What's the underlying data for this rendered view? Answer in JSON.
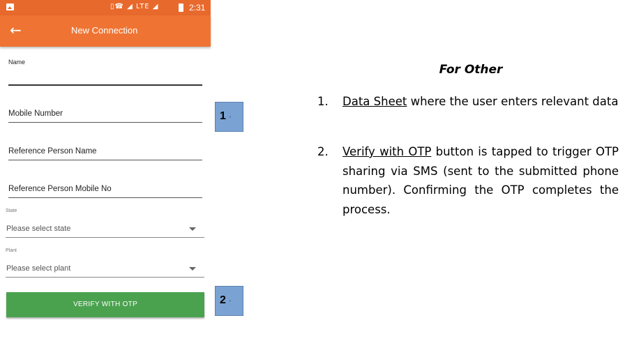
{
  "status_bar": {
    "network_icons": "▯☎ ◢ LTE ◢",
    "time": "2:31"
  },
  "app_bar": {
    "back_glyph": "←",
    "title": "New Connection"
  },
  "form": {
    "name_label": "Name",
    "mobile_label": "Mobile Number",
    "ref_name_label": "Reference Person Name",
    "ref_mobile_label": "Reference Person Mobile No",
    "state_label": "State",
    "state_placeholder": "Please select state",
    "plant_label": "Plant",
    "plant_placeholder": "Please select plant",
    "verify_button": "VERIFY WITH OTP"
  },
  "badges": [
    {
      "num": "1",
      "sub": "₂"
    },
    {
      "num": "2",
      "sub": "₂"
    }
  ],
  "notes": {
    "heading": "For Other",
    "items": [
      {
        "n": "1.",
        "link": "Data Sheet",
        "rest": " where the user enters relevant data"
      },
      {
        "n": "2.",
        "link": "Verify with OTP",
        "rest": " button is tapped to trigger OTP sharing via SMS (sent to the submitted phone number). Confirming the OTP completes the process."
      }
    ]
  },
  "colors": {
    "status_bar": "#e8692c",
    "app_bar": "#ef7433",
    "verify_button": "#4aa24f",
    "badge": "#7aa3d4"
  }
}
